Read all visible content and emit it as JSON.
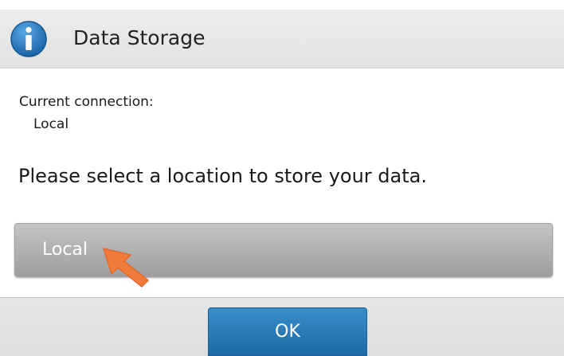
{
  "dialog": {
    "title": "Data Storage",
    "icon": "info-icon",
    "accent_color": "#1f72b8"
  },
  "connection": {
    "label": "Current connection:",
    "value": "Local"
  },
  "prompt": "Please select a location to store your data.",
  "options": [
    {
      "label": "Local"
    }
  ],
  "cursor": {
    "icon": "pointer-arrow-icon",
    "color": "#f07a3a"
  },
  "footer": {
    "ok_label": "OK",
    "ok_color": "#2a7dbf"
  }
}
